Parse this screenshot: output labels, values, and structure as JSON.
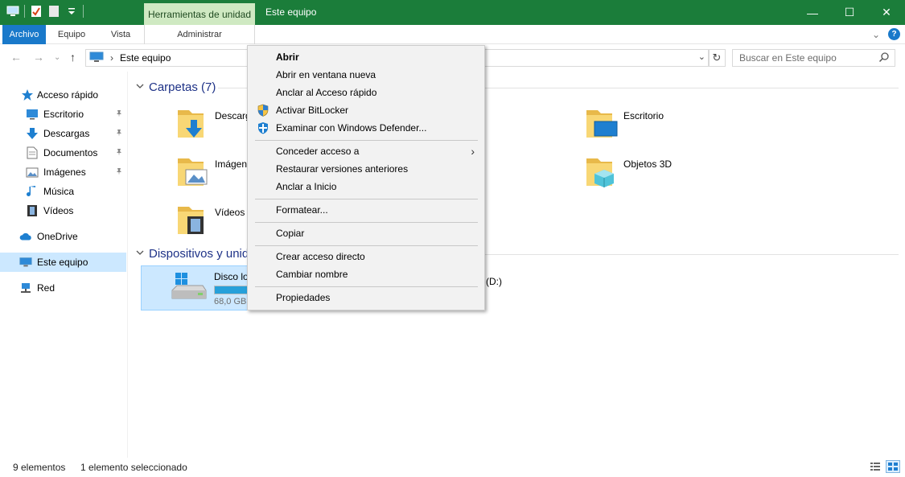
{
  "titlebar": {
    "context_tab_header": "Herramientas de unidad",
    "window_title": "Este equipo",
    "minimize_glyph": "—",
    "maximize_glyph": "☐",
    "close_glyph": "✕",
    "color": "#1b7d3a"
  },
  "ribbon": {
    "tabs": [
      {
        "label": "Archivo"
      },
      {
        "label": "Equipo"
      },
      {
        "label": "Vista"
      },
      {
        "label": "Administrar"
      }
    ],
    "expand_glyph": "⌄",
    "help_glyph": "?"
  },
  "address": {
    "back_glyph": "←",
    "forward_glyph": "→",
    "recent_glyph": "⌄",
    "up_glyph": "↑",
    "separator_glyph": "›",
    "path": "Este equipo",
    "dropdown_glyph": "⌄",
    "refresh_glyph": "↻",
    "search_placeholder": "Buscar en Este equipo"
  },
  "nav": {
    "items": [
      {
        "label": "Acceso rápido",
        "icon": "star-icon"
      },
      {
        "label": "Escritorio",
        "icon": "desktop-icon",
        "pinned": true
      },
      {
        "label": "Descargas",
        "icon": "download-icon",
        "pinned": true
      },
      {
        "label": "Documentos",
        "icon": "document-icon",
        "pinned": true
      },
      {
        "label": "Imágenes",
        "icon": "pictures-icon",
        "pinned": true
      },
      {
        "label": "Música",
        "icon": "music-icon"
      },
      {
        "label": "Vídeos",
        "icon": "videos-icon"
      },
      {
        "label": "OneDrive",
        "icon": "cloud-icon"
      },
      {
        "label": "Este equipo",
        "icon": "computer-icon",
        "selected": true
      },
      {
        "label": "Red",
        "icon": "network-icon"
      }
    ],
    "pin_glyph": "📌"
  },
  "content": {
    "folders_header": "Carpetas (7)",
    "folders": [
      {
        "label": "Descargas",
        "icon": "downloads-folder-icon"
      },
      {
        "label": "Escritorio",
        "icon": "desktop-folder-icon"
      },
      {
        "label": "Imágenes",
        "icon": "pictures-folder-icon"
      },
      {
        "label": "Objetos 3D",
        "icon": "3d-objects-folder-icon"
      },
      {
        "label": "Vídeos",
        "icon": "videos-folder-icon"
      }
    ],
    "devices_header": "Dispositivos y unidades",
    "drives": [
      {
        "label": "Disco local (C:)",
        "size": "68,0 GB",
        "fill": 0.78
      },
      {
        "label": "(D:)"
      }
    ]
  },
  "status": {
    "count": "9 elementos",
    "selection": "1 elemento seleccionado"
  },
  "context_menu": {
    "items": [
      {
        "label": "Abrir",
        "bold": true
      },
      {
        "label": "Abrir en ventana nueva"
      },
      {
        "label": "Anclar al Acceso rápido"
      },
      {
        "label": "Activar BitLocker",
        "icon": "shield-icon"
      },
      {
        "label": "Examinar con Windows Defender...",
        "icon": "defender-icon"
      },
      {
        "label": "Conceder acceso a",
        "submenu": true
      },
      {
        "label": "Restaurar versiones anteriores"
      },
      {
        "label": "Anclar a Inicio"
      },
      {
        "label": "Formatear..."
      },
      {
        "label": "Copiar"
      },
      {
        "label": "Crear acceso directo"
      },
      {
        "label": "Cambiar nombre"
      },
      {
        "label": "Propiedades"
      }
    ],
    "submenu_glyph": "›"
  }
}
